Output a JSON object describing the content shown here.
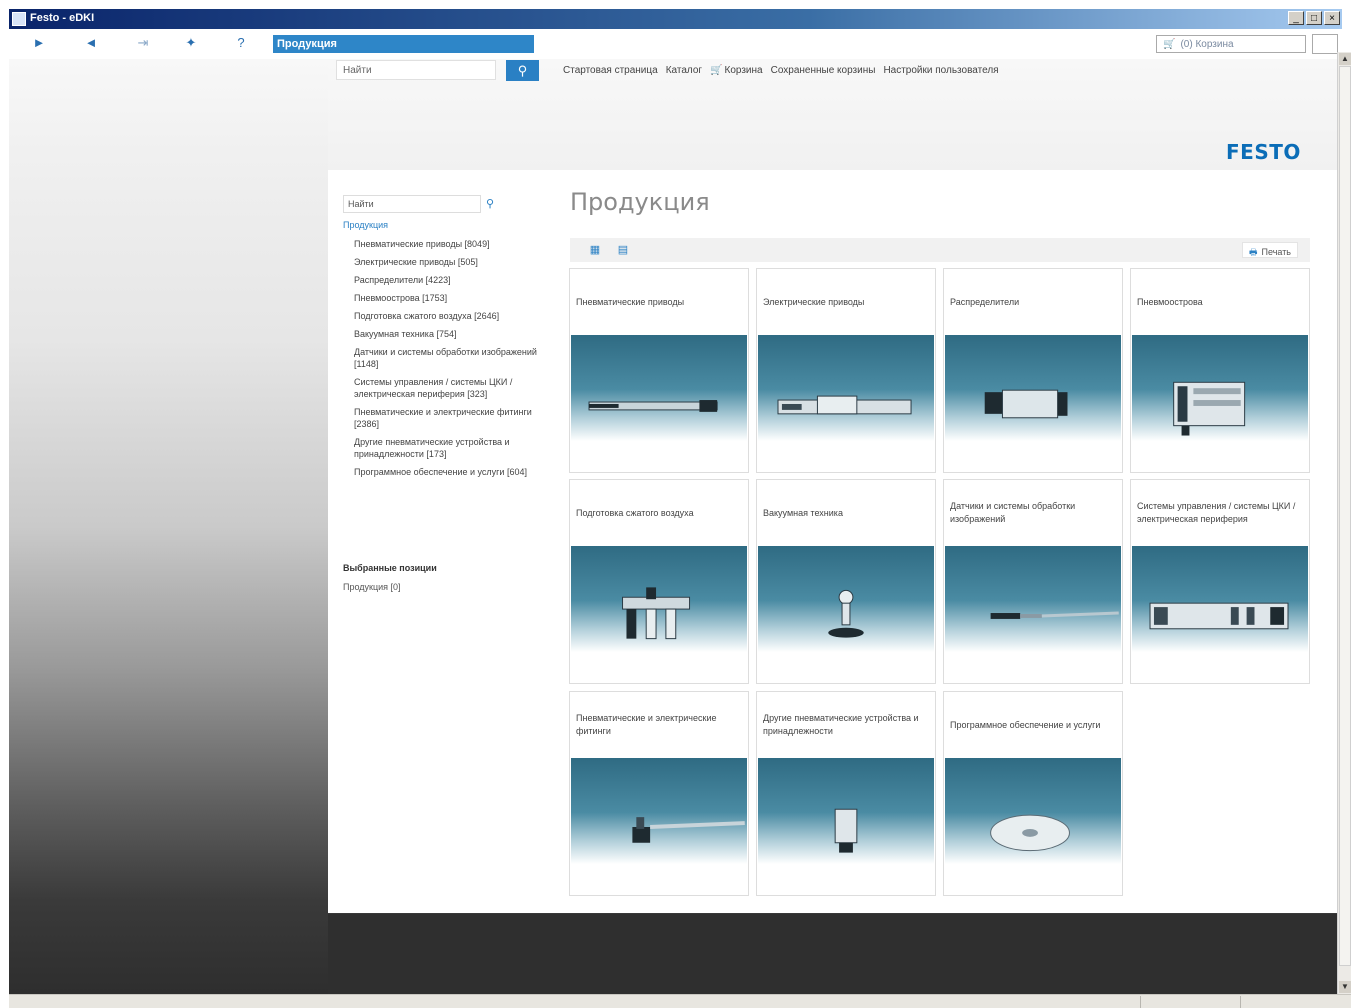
{
  "window": {
    "title": "Festo - eDKI"
  },
  "nav": {
    "tab_label": "Продукция",
    "cart_box": "(0) Корзина"
  },
  "top": {
    "search_placeholder": "Найти",
    "links": [
      "Стартовая страница",
      "Каталог",
      "Корзина",
      "Сохраненные корзины",
      "Настройки пользователя"
    ]
  },
  "logo": "FESTO",
  "sidebar": {
    "search_placeholder": "Найти",
    "root": "Продукция",
    "items": [
      "Пневматические приводы [8049]",
      "Электрические приводы [505]",
      "Распределители [4223]",
      "Пневмоострова [1753]",
      "Подготовка сжатого воздуха [2646]",
      "Вакуумная техника [754]",
      "Датчики и системы обработки изображений [1148]",
      "Системы управления / системы ЦКИ / электрическая периферия [323]",
      "Пневматические и электрические фитинги [2386]",
      "Другие пневматические устройства и принадлежности [173]",
      "Программное обеспечение и услуги [604]"
    ],
    "selected_heading": "Выбранные позиции",
    "selected_item": "Продукция [0]"
  },
  "main": {
    "title": "Продукция",
    "print_label": "Печать",
    "cards": [
      {
        "label": "Пневматические приводы",
        "icon": "cylinder-product"
      },
      {
        "label": "Электрические приводы",
        "icon": "electric-axis-product"
      },
      {
        "label": "Распределители",
        "icon": "valve-product"
      },
      {
        "label": "Пневмоострова",
        "icon": "valve-terminal-product"
      },
      {
        "label": "Подготовка сжатого воздуха",
        "icon": "air-prep-product"
      },
      {
        "label": "Вакуумная техника",
        "icon": "vacuum-cup-product"
      },
      {
        "label": "Датчики и системы обработки изображений",
        "icon": "sensor-product"
      },
      {
        "label": "Системы управления / системы ЦКИ / электрическая периферия",
        "icon": "controller-product"
      },
      {
        "label": "Пневматические и электрические фитинги",
        "icon": "fitting-product"
      },
      {
        "label": "Другие пневматические устройства и принадлежности",
        "icon": "silencer-product"
      },
      {
        "label": "Программное обеспечение и услуги",
        "icon": "cd-product"
      }
    ]
  },
  "colors": {
    "accent": "#2a80c4",
    "logo": "#0b6db7",
    "title_bar": "#0a246a"
  }
}
